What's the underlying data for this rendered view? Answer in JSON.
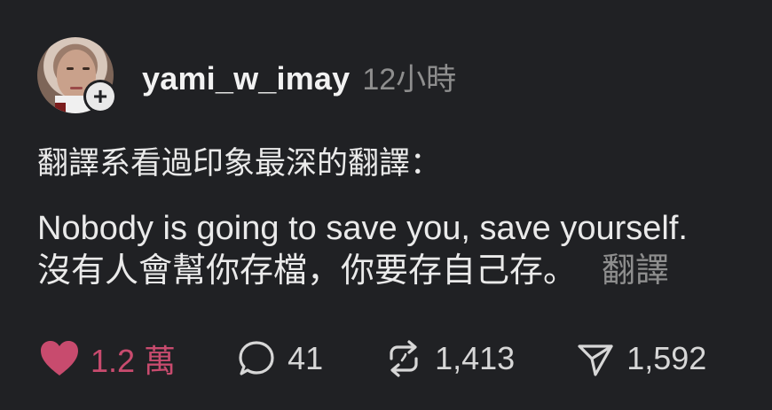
{
  "post": {
    "username": "yami_w_imay",
    "time_ago": "12小時",
    "text_line": "翻譯系看過印象最深的翻譯：",
    "quote_en": "Nobody is going to save you, save yourself.",
    "quote_zh": "沒有人會幫你存檔，你要存自己存。",
    "translate_label": "翻譯"
  },
  "actions": {
    "likes": "1.2 萬",
    "comments": "41",
    "reposts": "1,413",
    "shares": "1,592"
  },
  "colors": {
    "background": "#202124",
    "accent_like": "#c84b6e",
    "muted_text": "#8e8e8e"
  },
  "icons": {
    "follow": "plus-icon",
    "like": "heart-icon",
    "comment": "comment-bubble-icon",
    "repost": "repost-icon",
    "share": "paper-plane-icon"
  }
}
